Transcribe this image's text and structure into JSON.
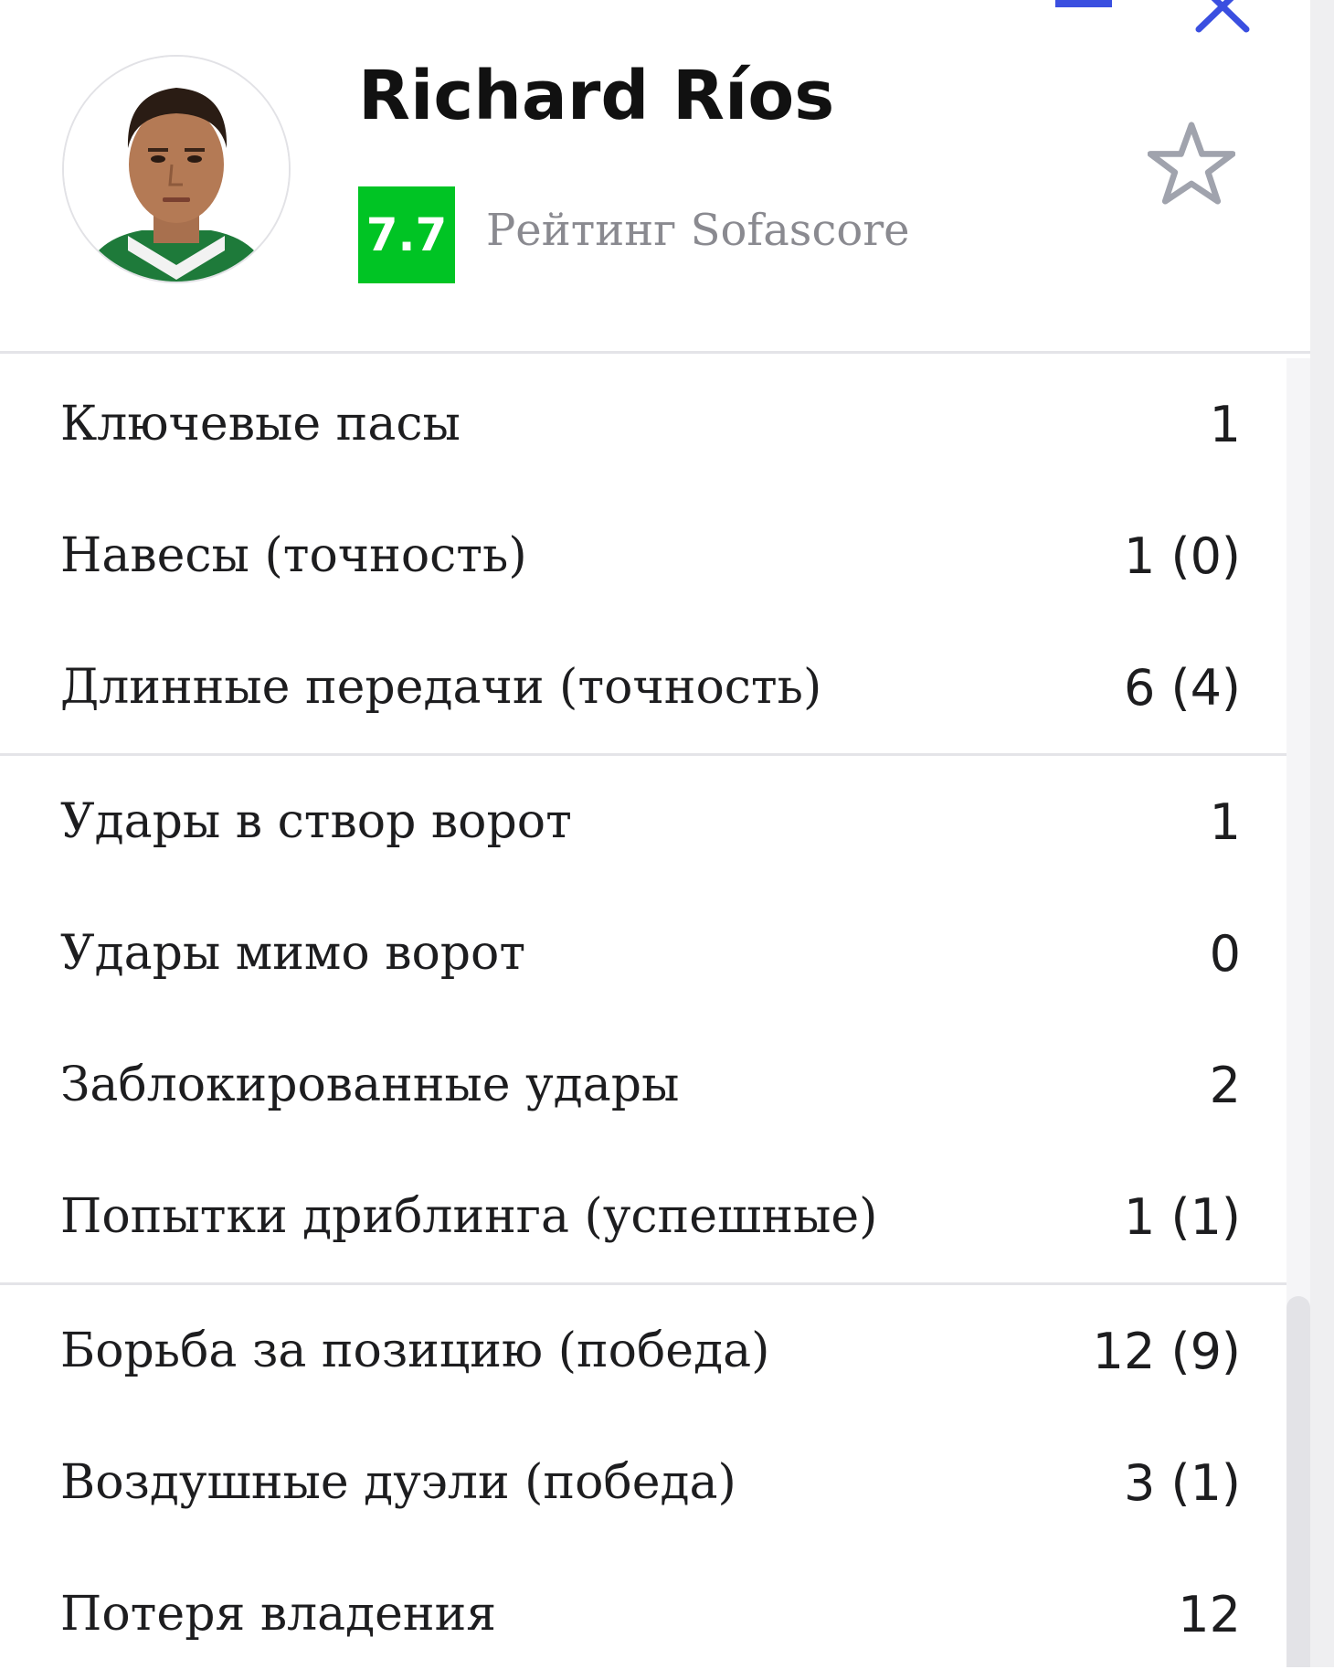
{
  "player": {
    "name": "Richard Ríos",
    "rating": "7.7",
    "rating_label": "Рейтинг Sofascore"
  },
  "colors": {
    "rating_badge": "#00c424",
    "window_controls": "#3a4fe0",
    "star": "#a0a3ad"
  },
  "icons": {
    "favorite": "star-outline-icon",
    "minimize": "minimize-icon",
    "close": "close-icon"
  },
  "stats": {
    "groups": [
      {
        "rows": [
          {
            "label": "Ключевые пасы",
            "value": "1"
          },
          {
            "label": "Навесы (точность)",
            "value": "1 (0)"
          },
          {
            "label": "Длинные передачи (точность)",
            "value": "6 (4)"
          }
        ]
      },
      {
        "rows": [
          {
            "label": "Удары в створ ворот",
            "value": "1"
          },
          {
            "label": "Удары мимо ворот",
            "value": "0"
          },
          {
            "label": "Заблокированные удары",
            "value": "2"
          },
          {
            "label": "Попытки дриблинга (успешные)",
            "value": "1 (1)"
          }
        ]
      },
      {
        "rows": [
          {
            "label": "Борьба за позицию (победа)",
            "value": "12 (9)"
          },
          {
            "label": "Воздушные дуэли (победа)",
            "value": "3 (1)"
          },
          {
            "label": "Потеря владения",
            "value": "12"
          }
        ]
      }
    ]
  }
}
